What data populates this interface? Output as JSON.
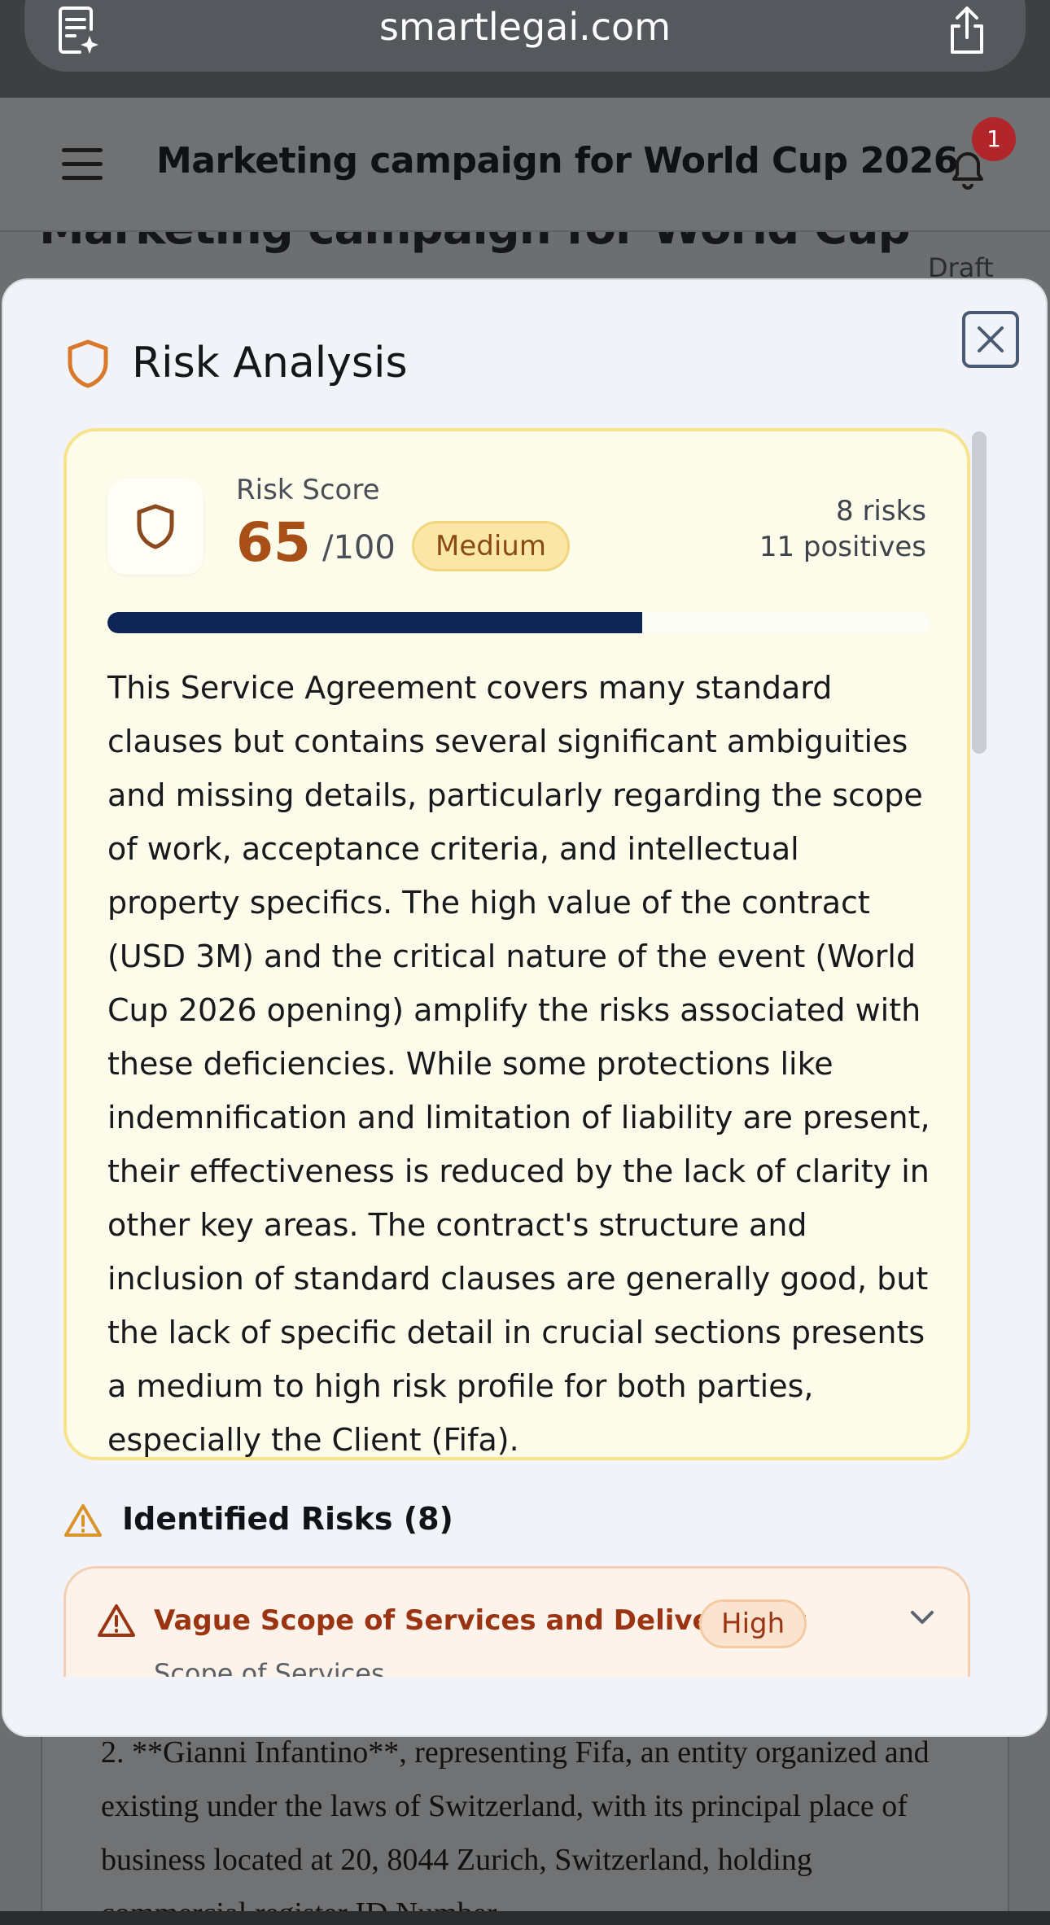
{
  "browser": {
    "url": "smartlegai.com",
    "left_icon": "page-sparkle-icon",
    "right_icon": "share-icon"
  },
  "header": {
    "title": "Marketing campaign for World Cup 2026",
    "notification_count": "1",
    "menu_icon": "hamburger-menu-icon",
    "bell_icon": "bell-icon"
  },
  "background_doc": {
    "title": "Marketing campaign for World Cup",
    "status": "Draft",
    "paragraph": "2.  **Gianni Infantino**, representing Fifa, an entity organized and existing under the laws of Switzerland, with its principal place of business located at 20, 8044 Zurich, Switzerland, holding commercial register ID Number"
  },
  "modal": {
    "title": "Risk Analysis",
    "close_icon": "close-icon",
    "score": {
      "label": "Risk Score",
      "value": "65",
      "max": "/100",
      "level": "Medium",
      "risks_text": "8 risks",
      "positives_text": "11 positives",
      "progress_percent": 65
    },
    "summary": "This Service Agreement covers many standard clauses but contains several significant ambiguities and missing details, particularly regarding the scope of work, acceptance criteria, and intellectual property specifics. The high value of the contract (USD 3M) and the critical nature of the event (World Cup 2026 opening) amplify the risks associated with these deficiencies. While some protections like indemnification and limitation of liability are present, their effectiveness is reduced by the lack of clarity in other key areas. The contract's structure and inclusion of standard clauses are generally good, but the lack of specific detail in crucial sections presents a medium to high risk profile for both parties, especially the Client (Fifa).",
    "identified_risks": {
      "title": "Identified Risks (8)",
      "items": [
        {
          "title": "Vague Scope of Services and Deliverables",
          "severity": "High",
          "section": "Scope of Services"
        }
      ]
    }
  },
  "colors": {
    "accent_orange": "#a84f17",
    "progress_navy": "#0e2555",
    "risk_red": "#9a3412",
    "card_yellow_bg": "#fdfbe9",
    "card_yellow_border": "#f6e48d"
  }
}
